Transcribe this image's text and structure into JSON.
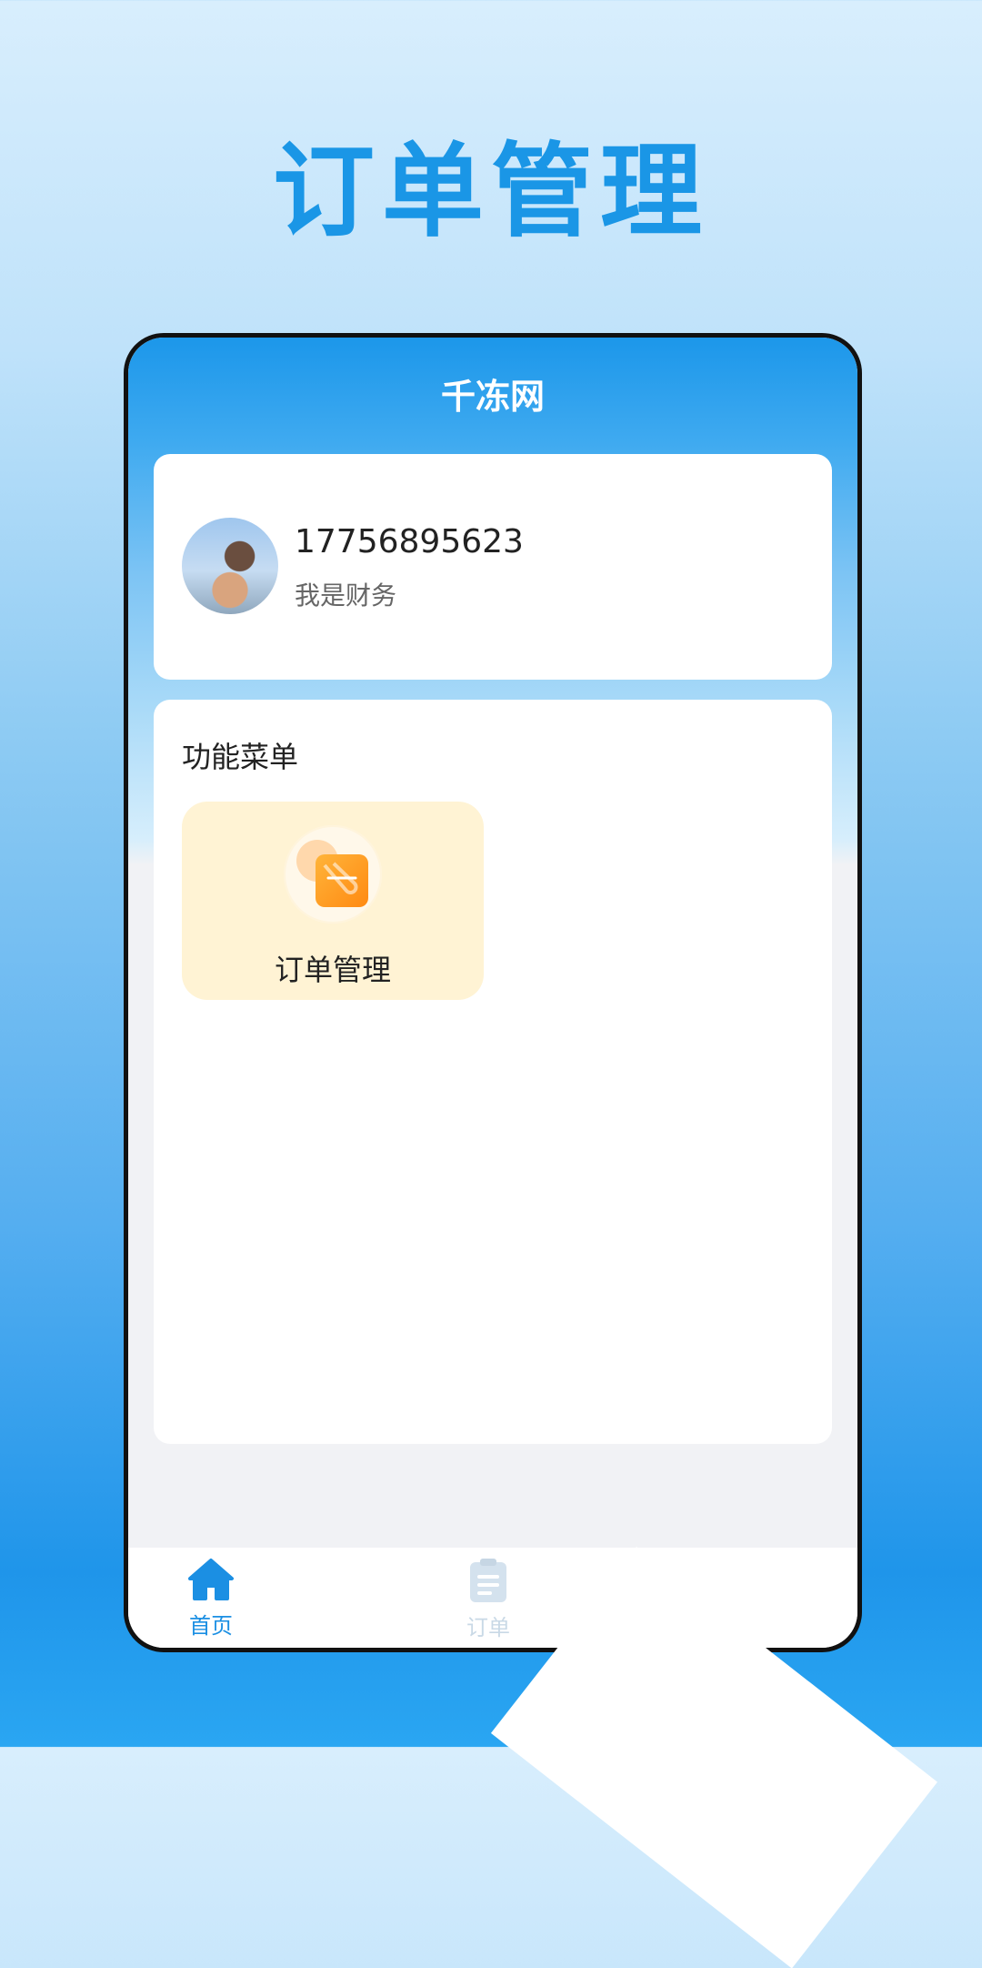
{
  "promo": {
    "title": "订单管理"
  },
  "app": {
    "title": "千冻网"
  },
  "profile": {
    "phone": "17756895623",
    "role": "我是财务"
  },
  "menu": {
    "heading": "功能菜单",
    "items": [
      {
        "label": "订单管理",
        "icon": "order-manage-icon"
      }
    ]
  },
  "tabbar": {
    "items": [
      {
        "label": "首页",
        "icon": "home-icon",
        "active": true
      },
      {
        "label": "订单",
        "icon": "clipboard-icon",
        "active": false
      }
    ]
  },
  "colors": {
    "primary": "#1b8fe3",
    "tile_bg": "#fff3d4",
    "accent_orange": "#ff8a12"
  }
}
